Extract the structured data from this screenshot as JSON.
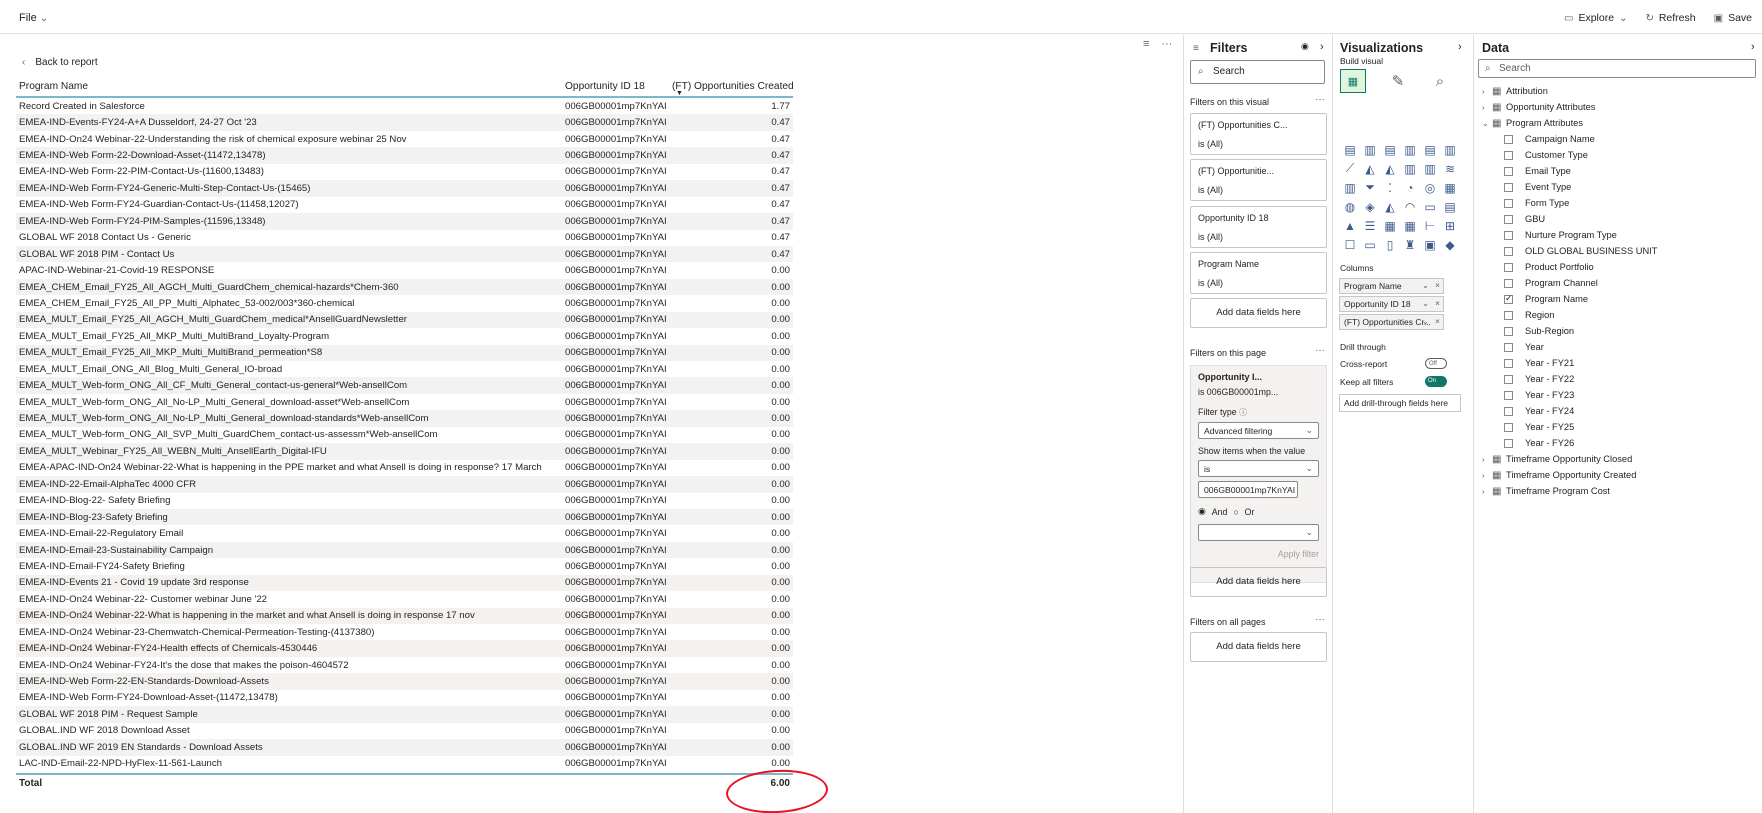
{
  "topbar": {
    "file_label": "File",
    "explore_label": "Explore",
    "refresh_label": "Refresh",
    "save_label": "Save"
  },
  "canvas": {
    "back_label": "Back to report"
  },
  "table": {
    "columns": [
      "Program Name",
      "Opportunity ID 18",
      "(FT) Opportunities Created"
    ],
    "rows": [
      [
        "Record Created in Salesforce",
        "006GB00001mp7KnYAI",
        "1.77"
      ],
      [
        "EMEA-IND-Events-FY24-A+A Dusseldorf, 24-27 Oct '23",
        "006GB00001mp7KnYAI",
        "0.47"
      ],
      [
        "EMEA-IND-On24 Webinar-22-Understanding the risk of chemical exposure webinar 25 Nov",
        "006GB00001mp7KnYAI",
        "0.47"
      ],
      [
        "EMEA-IND-Web Form-22-Download-Asset-(11472,13478)",
        "006GB00001mp7KnYAI",
        "0.47"
      ],
      [
        "EMEA-IND-Web Form-22-PIM-Contact-Us-(11600,13483)",
        "006GB00001mp7KnYAI",
        "0.47"
      ],
      [
        "EMEA-IND-Web Form-FY24-Generic-Multi-Step-Contact-Us-(15465)",
        "006GB00001mp7KnYAI",
        "0.47"
      ],
      [
        "EMEA-IND-Web Form-FY24-Guardian-Contact-Us-(11458,12027)",
        "006GB00001mp7KnYAI",
        "0.47"
      ],
      [
        "EMEA-IND-Web Form-FY24-PIM-Samples-(11596,13348)",
        "006GB00001mp7KnYAI",
        "0.47"
      ],
      [
        "GLOBAL WF 2018 Contact Us - Generic",
        "006GB00001mp7KnYAI",
        "0.47"
      ],
      [
        "GLOBAL WF 2018 PIM - Contact Us",
        "006GB00001mp7KnYAI",
        "0.47"
      ],
      [
        "APAC-IND-Webinar-21-Covid-19 RESPONSE",
        "006GB00001mp7KnYAI",
        "0.00"
      ],
      [
        "EMEA_CHEM_Email_FY25_All_AGCH_Multi_GuardChem_chemical-hazards*Chem-360",
        "006GB00001mp7KnYAI",
        "0.00"
      ],
      [
        "EMEA_CHEM_Email_FY25_All_PP_Multi_Alphatec_53-002/003*360-chemical",
        "006GB00001mp7KnYAI",
        "0.00"
      ],
      [
        "EMEA_MULT_Email_FY25_All_AGCH_Multi_GuardChem_medical*AnsellGuardNewsletter",
        "006GB00001mp7KnYAI",
        "0.00"
      ],
      [
        "EMEA_MULT_Email_FY25_All_MKP_Multi_MultiBrand_Loyalty-Program",
        "006GB00001mp7KnYAI",
        "0.00"
      ],
      [
        "EMEA_MULT_Email_FY25_All_MKP_Multi_MultiBrand_permeation*S8",
        "006GB00001mp7KnYAI",
        "0.00"
      ],
      [
        "EMEA_MULT_Email_ONG_All_Blog_Multi_General_IO-broad",
        "006GB00001mp7KnYAI",
        "0.00"
      ],
      [
        "EMEA_MULT_Web-form_ONG_All_CF_Multi_General_contact-us-general*Web-ansellCom",
        "006GB00001mp7KnYAI",
        "0.00"
      ],
      [
        "EMEA_MULT_Web-form_ONG_All_No-LP_Multi_General_download-asset*Web-ansellCom",
        "006GB00001mp7KnYAI",
        "0.00"
      ],
      [
        "EMEA_MULT_Web-form_ONG_All_No-LP_Multi_General_download-standards*Web-ansellCom",
        "006GB00001mp7KnYAI",
        "0.00"
      ],
      [
        "EMEA_MULT_Web-form_ONG_All_SVP_Multi_GuardChem_contact-us-assessm*Web-ansellCom",
        "006GB00001mp7KnYAI",
        "0.00"
      ],
      [
        "EMEA_MULT_Webinar_FY25_All_WEBN_Multi_AnsellEarth_Digital-IFU",
        "006GB00001mp7KnYAI",
        "0.00"
      ],
      [
        "EMEA-APAC-IND-On24 Webinar-22-What is happening in the PPE market and what Ansell is doing in response? 17 March",
        "006GB00001mp7KnYAI",
        "0.00"
      ],
      [
        "EMEA-IND-22-Email-AlphaTec 4000 CFR",
        "006GB00001mp7KnYAI",
        "0.00"
      ],
      [
        "EMEA-IND-Blog-22- Safety Briefing",
        "006GB00001mp7KnYAI",
        "0.00"
      ],
      [
        "EMEA-IND-Blog-23-Safety Briefing",
        "006GB00001mp7KnYAI",
        "0.00"
      ],
      [
        "EMEA-IND-Email-22-Regulatory Email",
        "006GB00001mp7KnYAI",
        "0.00"
      ],
      [
        "EMEA-IND-Email-23-Sustainability Campaign",
        "006GB00001mp7KnYAI",
        "0.00"
      ],
      [
        "EMEA-IND-Email-FY24-Safety Briefing",
        "006GB00001mp7KnYAI",
        "0.00"
      ],
      [
        "EMEA-IND-Events 21 - Covid 19 update 3rd response",
        "006GB00001mp7KnYAI",
        "0.00"
      ],
      [
        "EMEA-IND-On24 Webinar-22- Customer webinar June '22",
        "006GB00001mp7KnYAI",
        "0.00"
      ],
      [
        "EMEA-IND-On24 Webinar-22-What is happening in the market and what Ansell is doing in response 17 nov",
        "006GB00001mp7KnYAI",
        "0.00"
      ],
      [
        "EMEA-IND-On24 Webinar-23-Chemwatch-Chemical-Permeation-Testing-(4137380)",
        "006GB00001mp7KnYAI",
        "0.00"
      ],
      [
        "EMEA-IND-On24 Webinar-FY24-Health effects of Chemicals-4530446",
        "006GB00001mp7KnYAI",
        "0.00"
      ],
      [
        "EMEA-IND-On24 Webinar-FY24-It's the dose that makes the poison-4604572",
        "006GB00001mp7KnYAI",
        "0.00"
      ],
      [
        "EMEA-IND-Web Form-22-EN-Standards-Download-Assets",
        "006GB00001mp7KnYAI",
        "0.00"
      ],
      [
        "EMEA-IND-Web Form-FY24-Download-Asset-(11472,13478)",
        "006GB00001mp7KnYAI",
        "0.00"
      ],
      [
        "GLOBAL WF 2018 PIM - Request Sample",
        "006GB00001mp7KnYAI",
        "0.00"
      ],
      [
        "GLOBAL.IND WF 2018 Download Asset",
        "006GB00001mp7KnYAI",
        "0.00"
      ],
      [
        "GLOBAL.IND WF 2019 EN Standards - Download Assets",
        "006GB00001mp7KnYAI",
        "0.00"
      ],
      [
        "LAC-IND-Email-22-NPD-HyFlex-11-561-Launch",
        "006GB00001mp7KnYAI",
        "0.00"
      ]
    ],
    "total_label": "Total",
    "total_value": "6.00"
  },
  "filters": {
    "title": "Filters",
    "search_placeholder": "Search",
    "on_visual_label": "Filters on this visual",
    "cards": [
      {
        "name": "(FT) Opportunities C...",
        "state": "is (All)"
      },
      {
        "name": "(FT) Opportunitie...",
        "state": "is (All)"
      },
      {
        "name": "Opportunity ID 18",
        "state": "is (All)"
      },
      {
        "name": "Program Name",
        "state": "is (All)"
      }
    ],
    "add_fields_label": "Add data fields here",
    "on_page_label": "Filters on this page",
    "page_card": {
      "name": "Opportunity I...",
      "state": "is 006GB00001mp...",
      "filter_type_label": "Filter type",
      "filter_type_value": "Advanced filtering",
      "show_items_label": "Show items when the value",
      "operator_value": "is",
      "value": "006GB00001mp7KnYAI",
      "and_label": "And",
      "or_label": "Or",
      "apply_label": "Apply filter"
    },
    "on_all_pages_label": "Filters on all pages"
  },
  "visualizations": {
    "title": "Visualizations",
    "build_label": "Build visual",
    "columns_label": "Columns",
    "wells": [
      "Program Name",
      "Opportunity ID 18",
      "(FT) Opportunities Cr..."
    ],
    "drill_label": "Drill through",
    "cross_report_label": "Cross-report",
    "cross_report_state": "Off",
    "keep_filters_label": "Keep all filters",
    "keep_filters_state": "On",
    "add_drill_label": "Add drill-through fields here"
  },
  "data": {
    "title": "Data",
    "search_placeholder": "Search",
    "tables": [
      {
        "name": "Attribution",
        "expanded": false
      },
      {
        "name": "Opportunity Attributes",
        "expanded": false
      },
      {
        "name": "Program Attributes",
        "expanded": true
      }
    ],
    "fields": [
      {
        "name": "Campaign Name",
        "checked": false
      },
      {
        "name": "Customer Type",
        "checked": false
      },
      {
        "name": "Email Type",
        "checked": false
      },
      {
        "name": "Event Type",
        "checked": false
      },
      {
        "name": "Form Type",
        "checked": false
      },
      {
        "name": "GBU",
        "checked": false
      },
      {
        "name": "Nurture Program Type",
        "checked": false
      },
      {
        "name": "OLD GLOBAL BUSINESS UNIT",
        "checked": false
      },
      {
        "name": "Product Portfolio",
        "checked": false
      },
      {
        "name": "Program Channel",
        "checked": false
      },
      {
        "name": "Program Name",
        "checked": true
      },
      {
        "name": "Region",
        "checked": false
      },
      {
        "name": "Sub-Region",
        "checked": false
      },
      {
        "name": "Year",
        "checked": false
      },
      {
        "name": "Year - FY21",
        "checked": false
      },
      {
        "name": "Year - FY22",
        "checked": false
      },
      {
        "name": "Year - FY23",
        "checked": false
      },
      {
        "name": "Year - FY24",
        "checked": false
      },
      {
        "name": "Year - FY25",
        "checked": false
      },
      {
        "name": "Year - FY26",
        "checked": false
      }
    ],
    "bottom_tables": [
      "Timeframe Opportunity Closed",
      "Timeframe Opportunity Created",
      "Timeframe Program Cost"
    ]
  },
  "colors": {
    "accent": "#117865",
    "toggle_on": "#117865",
    "header_rule": "#7fb7c8",
    "annotation_circle": "#e81123"
  }
}
